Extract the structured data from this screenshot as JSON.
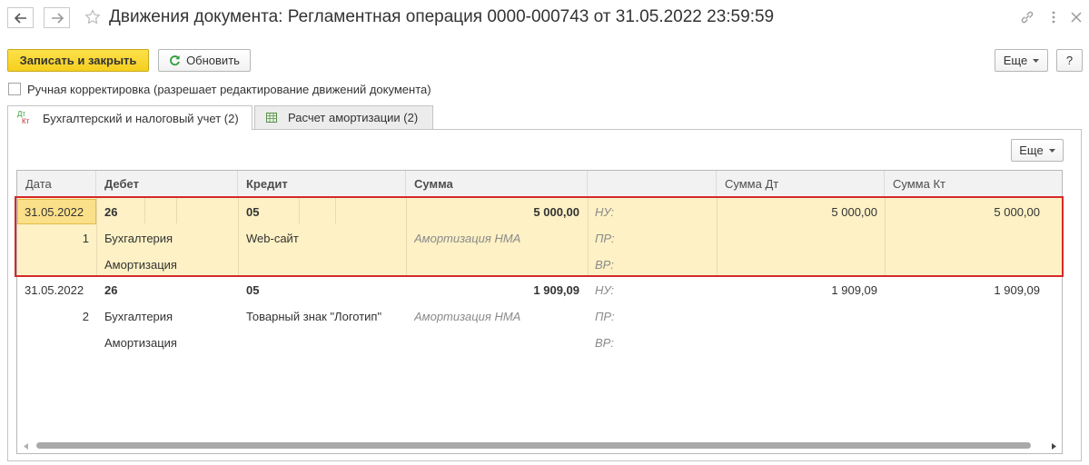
{
  "window": {
    "title": "Движения документа: Регламентная операция 0000-000743 от 31.05.2022 23:59:59"
  },
  "toolbar": {
    "save_close_label": "Записать и закрыть",
    "refresh_label": "Обновить",
    "more_label": "Еще",
    "help_label": "?"
  },
  "manual_correction": {
    "label": "Ручная корректировка (разрешает редактирование движений документа)",
    "checked": false
  },
  "tabs": [
    {
      "label": "Бухгалтерский и налоговый учет (2)",
      "icon": "dt-kt-icon",
      "active": true
    },
    {
      "label": "Расчет амортизации (2)",
      "icon": "table-icon",
      "active": false
    }
  ],
  "panel": {
    "more_label": "Еще"
  },
  "table": {
    "columns": [
      "Дата",
      "Дебет",
      "Кредит",
      "Сумма",
      "",
      "Сумма Дт",
      "Сумма Кт"
    ],
    "records": [
      {
        "date": "31.05.2022",
        "number": "1",
        "debit_account": "26",
        "debit_sub1": "Бухгалтерия",
        "debit_sub2": "Амортизация",
        "credit_account": "05",
        "credit_sub1": "Web-сайт",
        "amount": "5 000,00",
        "content": "Амортизация НМА",
        "nu_label": "НУ:",
        "pr_label": "ПР:",
        "vr_label": "ВР:",
        "sum_dt": "5 000,00",
        "sum_kt": "5 000,00",
        "selected": true
      },
      {
        "date": "31.05.2022",
        "number": "2",
        "debit_account": "26",
        "debit_sub1": "Бухгалтерия",
        "debit_sub2": "Амортизация",
        "credit_account": "05",
        "credit_sub1": "Товарный знак \"Логотип\"",
        "amount": "1 909,09",
        "content": "Амортизация НМА",
        "nu_label": "НУ:",
        "pr_label": "ПР:",
        "vr_label": "ВР:",
        "sum_dt": "1 909,09",
        "sum_kt": "1 909,09",
        "selected": false
      }
    ]
  },
  "colors": {
    "primary_button": "#f5cf1f",
    "selected_row": "#fdf1c5",
    "active_cell": "#fbe08a",
    "highlight_frame": "#d42a2a"
  }
}
